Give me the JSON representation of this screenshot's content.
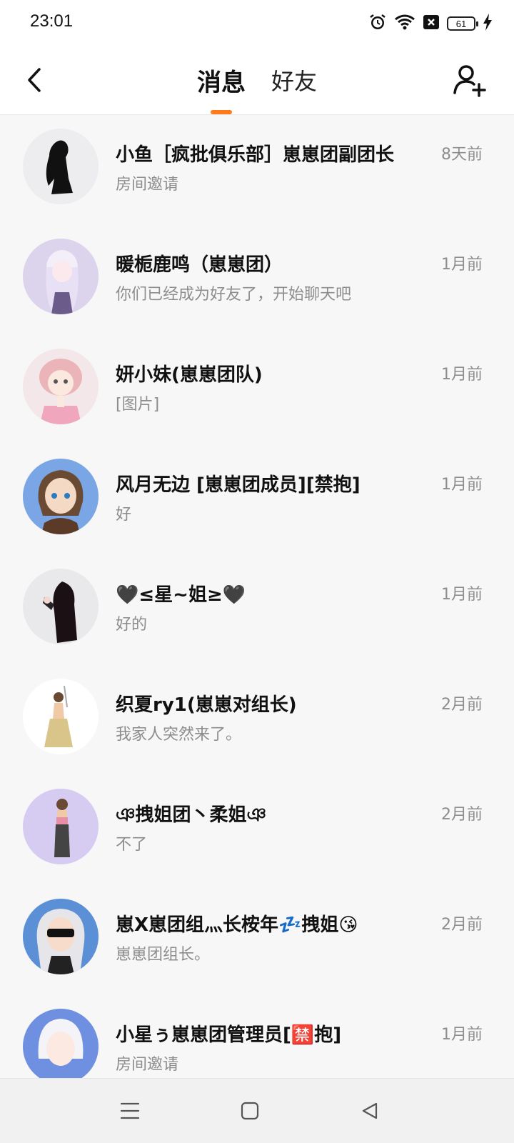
{
  "status_bar": {
    "time": "23:01",
    "battery": "61",
    "icons": [
      "alarm-icon",
      "wifi-icon",
      "sim-x-icon",
      "battery-icon",
      "charging-icon"
    ]
  },
  "header": {
    "tabs": [
      {
        "label": "消息",
        "active": true
      },
      {
        "label": "好友",
        "active": false
      }
    ],
    "accent_color": "#ff7a1a"
  },
  "conversations": [
    {
      "name": "小鱼［疯批俱乐部］崽崽团副团长",
      "preview": "房间邀请",
      "time": "8天前"
    },
    {
      "name": "暖栀鹿鸣（崽崽团）",
      "preview": "你们已经成为好友了，开始聊天吧",
      "time": "1月前"
    },
    {
      "name": "妍小妹(崽崽团队)",
      "preview": "[图片]",
      "time": "1月前"
    },
    {
      "name": "风月无边 [崽崽团成员][禁抱]",
      "preview": "好",
      "time": "1月前"
    },
    {
      "name": "🖤≤星~姐≥🖤",
      "preview": "好的",
      "time": "1月前"
    },
    {
      "name": "织夏ry1(崽崽对组长)",
      "preview": "我家人突然来了。",
      "time": "2月前"
    },
    {
      "name": "ঞ拽姐团丶柔姐ঞ",
      "preview": "不了",
      "time": "2月前"
    },
    {
      "name": "崽X崽团组灬长桉年💤拽姐😘",
      "preview": "崽崽团组长。",
      "time": "2月前"
    },
    {
      "name": "小星ぅ崽崽团管理员[🈲抱]",
      "preview": "房间邀请",
      "time": "1月前"
    }
  ],
  "nav": {
    "icons": [
      "menu-icon",
      "home-icon",
      "back-triangle-icon"
    ]
  }
}
